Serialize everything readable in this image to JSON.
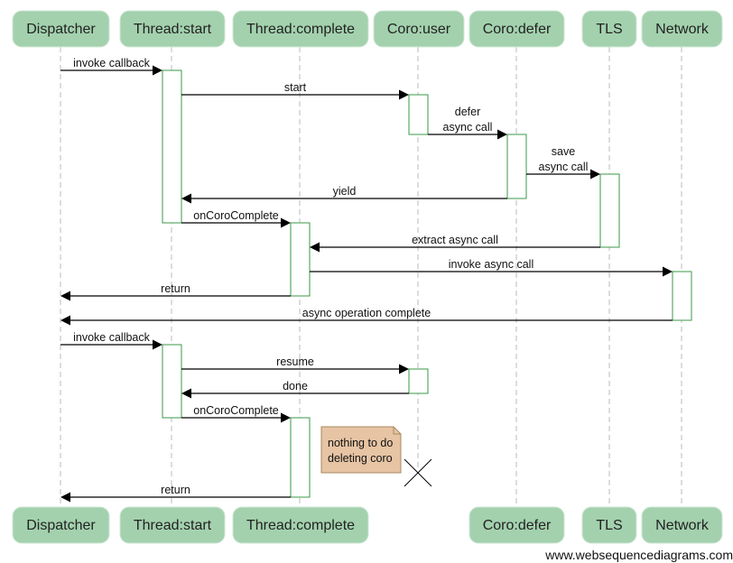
{
  "diagram": {
    "actors": [
      {
        "id": "dispatcher",
        "label": "Dispatcher",
        "in_footer": true
      },
      {
        "id": "thread_start",
        "label": "Thread:start",
        "in_footer": true
      },
      {
        "id": "thread_complete",
        "label": "Thread:complete",
        "in_footer": true
      },
      {
        "id": "coro_user",
        "label": "Coro:user",
        "in_footer": false
      },
      {
        "id": "coro_defer",
        "label": "Coro:defer",
        "in_footer": true
      },
      {
        "id": "tls",
        "label": "TLS",
        "in_footer": true
      },
      {
        "id": "network",
        "label": "Network",
        "in_footer": true
      }
    ],
    "messages": [
      {
        "from": "dispatcher",
        "to": "thread_start",
        "lines": [
          "invoke callback"
        ]
      },
      {
        "from": "thread_start",
        "to": "coro_user",
        "lines": [
          "start"
        ]
      },
      {
        "from": "coro_user",
        "to": "coro_defer",
        "lines": [
          "defer",
          "async call"
        ]
      },
      {
        "from": "coro_defer",
        "to": "tls",
        "lines": [
          "save",
          "async call"
        ]
      },
      {
        "from": "coro_defer",
        "to": "thread_start",
        "lines": [
          "yield"
        ]
      },
      {
        "from": "thread_start",
        "to": "thread_complete",
        "lines": [
          "onCoroComplete"
        ]
      },
      {
        "from": "tls",
        "to": "thread_complete",
        "lines": [
          "extract async call"
        ]
      },
      {
        "from": "thread_complete",
        "to": "network",
        "lines": [
          "invoke async call"
        ]
      },
      {
        "from": "thread_complete",
        "to": "dispatcher",
        "lines": [
          "return"
        ]
      },
      {
        "from": "network",
        "to": "dispatcher",
        "lines": [
          "async operation complete"
        ]
      },
      {
        "from": "dispatcher",
        "to": "thread_start",
        "lines": [
          "invoke callback"
        ]
      },
      {
        "from": "thread_start",
        "to": "coro_user",
        "lines": [
          "resume"
        ]
      },
      {
        "from": "coro_user",
        "to": "thread_start",
        "lines": [
          "done"
        ]
      },
      {
        "from": "thread_start",
        "to": "thread_complete",
        "lines": [
          "onCoroComplete"
        ]
      },
      {
        "from": "thread_complete",
        "to": "dispatcher",
        "lines": [
          "return"
        ]
      }
    ],
    "note": {
      "lines": [
        "nothing to do",
        "deleting coro"
      ]
    },
    "destroyed_actor": "coro_user",
    "colors": {
      "actor_fill": "#a3d1ae",
      "activation_stroke": "#3a9a47",
      "note_fill": "#e6c4a4"
    }
  },
  "watermark": "www.websequencediagrams.com"
}
